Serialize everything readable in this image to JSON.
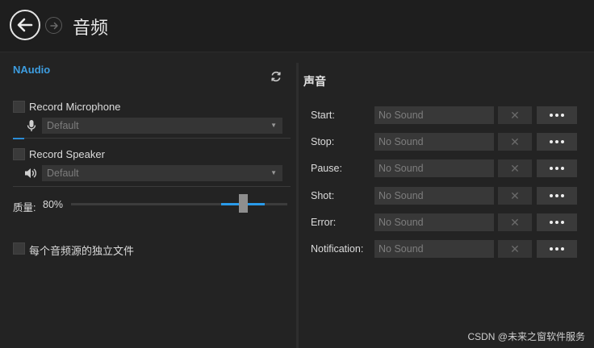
{
  "header": {
    "title": "音频"
  },
  "left": {
    "section_title": "NAudio",
    "record_microphone": {
      "label": "Record Microphone",
      "checked": false,
      "device": "Default"
    },
    "record_speaker": {
      "label": "Record Speaker",
      "checked": false,
      "device": "Default"
    },
    "quality": {
      "label": "质量:",
      "value_text": "80%",
      "value": 0.8
    },
    "separate_files": {
      "label": "每个音频源的独立文件",
      "checked": false
    }
  },
  "right": {
    "title": "声音",
    "rows": [
      {
        "label": "Start:",
        "value": "No Sound"
      },
      {
        "label": "Stop:",
        "value": "No Sound"
      },
      {
        "label": "Pause:",
        "value": "No Sound"
      },
      {
        "label": "Shot:",
        "value": "No Sound"
      },
      {
        "label": "Error:",
        "value": "No Sound"
      },
      {
        "label": "Notification:",
        "value": "No Sound"
      }
    ],
    "clear_glyph": "✕"
  },
  "watermark": "CSDN @未来之窗软件服务",
  "colors": {
    "accent": "#2a9bea",
    "background": "#232323",
    "header": "#1e1e1e"
  },
  "icons": [
    "back-arrow-icon",
    "forward-arrow-icon",
    "refresh-icon",
    "microphone-icon",
    "speaker-icon",
    "close-icon",
    "more-icon"
  ]
}
